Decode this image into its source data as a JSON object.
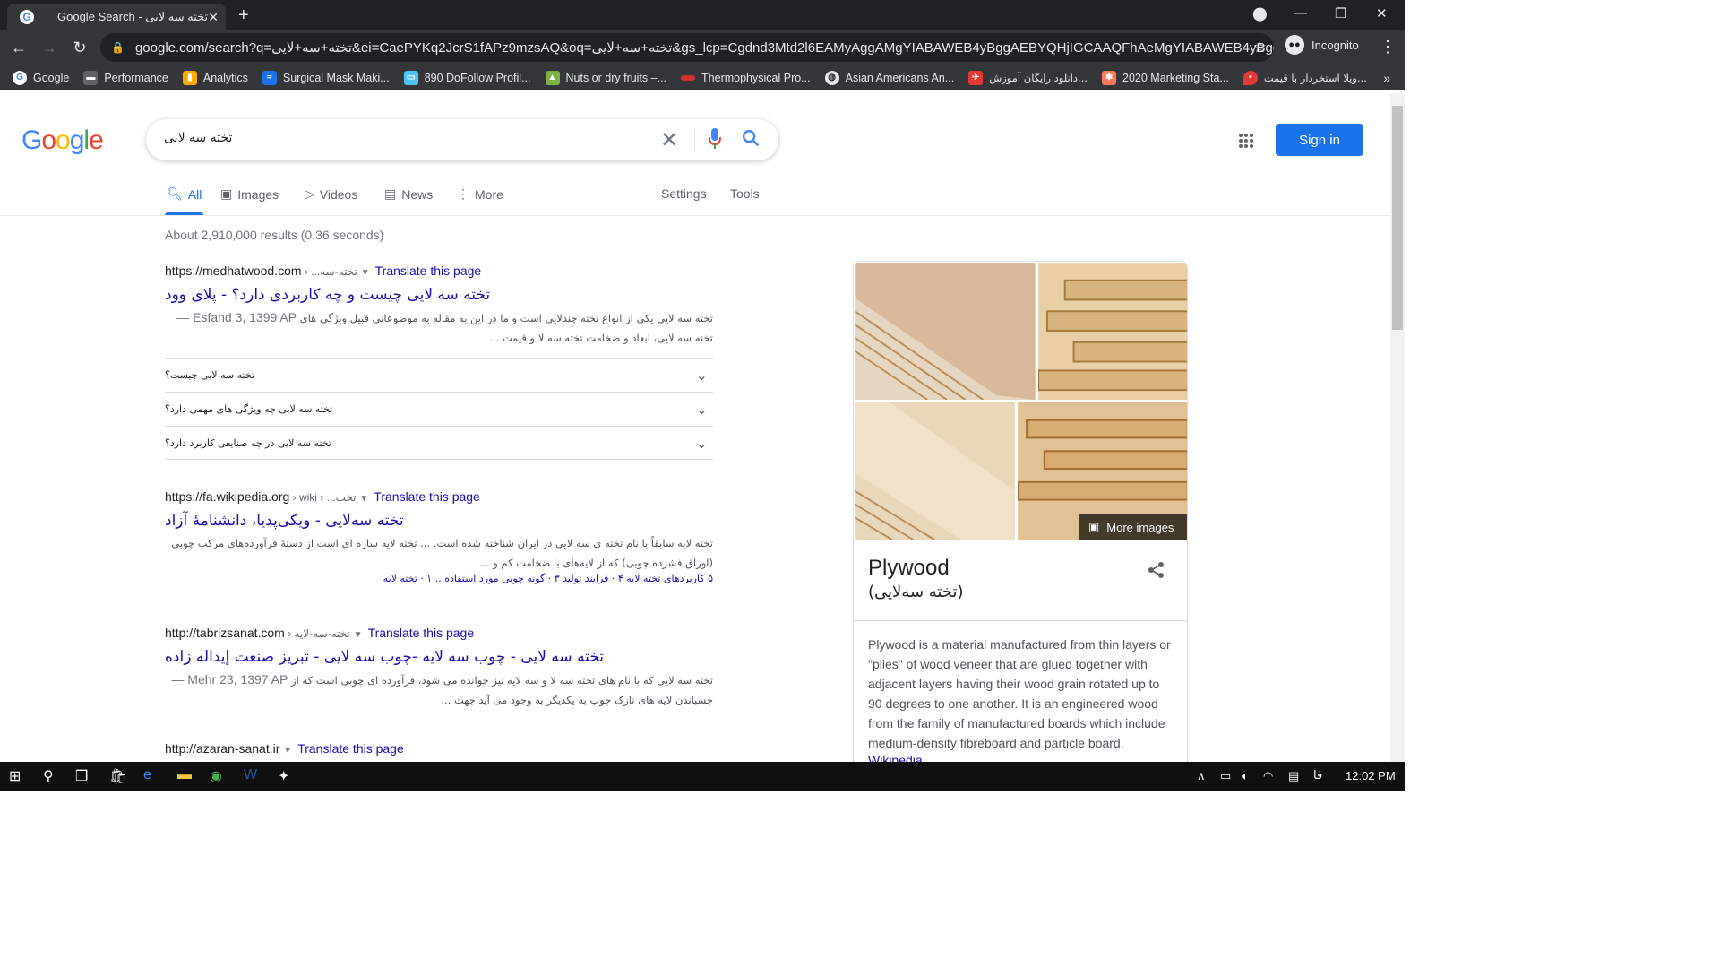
{
  "browser": {
    "tab_title": "Google Search - تخته سه لایی",
    "new_tab": "+",
    "url": "google.com/search?q=تخته+سه+لایی&ei=CaePYKq2JcrS1fAPz9mzsAQ&oq=تخته+سه+لایی&gs_lcp=Cgdnd3Mtd2l6EAMyAggAMgYIABAWEB4yBggAEBYQHjIGCAAQFhAeMgYIABAWEB4yBggAEBY...",
    "incognito_label": "Incognito",
    "bookmarks": [
      {
        "label": "Google",
        "icon": "google-icon",
        "color": "#4285f4"
      },
      {
        "label": "Performance",
        "icon": "car-icon",
        "color": "#9aa0a6"
      },
      {
        "label": "Analytics",
        "icon": "analytics-icon",
        "color": "#f9ab00"
      },
      {
        "label": "Surgical Mask Maki...",
        "icon": "wave-icon",
        "color": "#1a73e8"
      },
      {
        "label": "890 DoFollow Profil...",
        "icon": "image-icon",
        "color": "#4fc3f7"
      },
      {
        "label": "Nuts or dry fruits –...",
        "icon": "tree-icon",
        "color": "#7cb342"
      },
      {
        "label": "Thermophysical Pro...",
        "icon": "ring-icon",
        "color": "#d32f2f"
      },
      {
        "label": "Asian Americans An...",
        "icon": "globe-icon",
        "color": "#e8eaed"
      },
      {
        "label": "دانلود رایگان آموزش...",
        "icon": "bird-icon",
        "color": "#e53935"
      },
      {
        "label": "2020 Marketing Sta...",
        "icon": "hubspot-icon",
        "color": "#ff7a59"
      },
      {
        "label": "ویلا استخردار با قیمت...",
        "icon": "pin-icon",
        "color": "#e53935"
      }
    ],
    "bookmarks_more": "»"
  },
  "search": {
    "logo": "Google",
    "query": "تخته سه لایی",
    "signin": "Sign in",
    "tabs": [
      {
        "label": "All",
        "icon": "search-icon"
      },
      {
        "label": "Images",
        "icon": "image-icon"
      },
      {
        "label": "Videos",
        "icon": "video-icon"
      },
      {
        "label": "News",
        "icon": "news-icon"
      },
      {
        "label": "More",
        "icon": "more-icon"
      }
    ],
    "settings": "Settings",
    "tools": "Tools",
    "stats": "About 2,910,000 results (0.36 seconds)"
  },
  "results": [
    {
      "domain": "https://medhatwood.com",
      "crumb": " › ...تخته-سه",
      "translate": "Translate this page",
      "title": "تخته سه لایی چیست و چه کاربردی دارد؟ - پلای وود",
      "date": "Esfand 3, 1399 AP —",
      "snippet1": "تخته سه لایی یکی از انواع تخته چندلایی است و ما در این به مقاله به موضوعاتی قبیل ویژگی های",
      "snippet2": "تخته سه لایی، ابعاد و ضخامت تخته سه لا و قیمت ..."
    },
    {
      "domain": "https://fa.wikipedia.org",
      "crumb": " › wiki › ...تخت",
      "translate": "Translate this page",
      "title": "تخته سه‌لایی - ویکی‌پدیا، دانشنامهٔ آزاد",
      "snippet1": "تخته لایه سابقاً با نام تخته ی سه لایی در ایران شناخته شده است. ... تخته لایه سازه ای است از دستهٔ فرآورده‌های مرکب چوبی",
      "snippet2": "(اوراق فشرده چوبی) که از لایه‌های با ضخامت کم و ...",
      "sitelinks": "۵ کاربردهای تخته لایه ۴ · فرایند تولید ۳ · گونه چوبی مورد استفاده... ۱ · تخته لایه"
    },
    {
      "domain": "http://tabrizsanat.com",
      "crumb": " › تخته-سه-لایه",
      "translate": "Translate this page",
      "title": "تخته سه لایی - چوب سه لایه -چوب سه لایی - تبریز صنعت إیداله زاده",
      "date": "Mehr 23, 1397 AP —",
      "snippet1": "تخته سه لایی که با نام های تخته سه لا و سه لایه نیز خوانده می شود، فرآورده ای چوبی است که از",
      "snippet2": "چسباندن لایه های نازک چوب به یکدیگر به وجود می آید.جهت ..."
    },
    {
      "domain": "http://azaran-sanat.ir",
      "translate": "Translate this page"
    }
  ],
  "faq": [
    "تخته سه لایی چیست؟",
    "تخته سه لایی چه ویژگی های مهمی دارد؟",
    "تخته سه لایی در چه صنایعی کاربرد دارد؟"
  ],
  "knowledge_panel": {
    "more_images": "More images",
    "title": "Plywood",
    "subtitle": "(تخته سه‌لایی)",
    "description": "Plywood is a material manufactured from thin layers or \"plies\" of wood veneer that are glued together with adjacent layers having their wood grain rotated up to 90 degrees to one another. It is an engineered wood from the family of manufactured boards which include medium-density fibreboard and particle board.",
    "source": "Wikipedia"
  },
  "taskbar": {
    "lang": "فا",
    "time": "12:02 PM"
  }
}
